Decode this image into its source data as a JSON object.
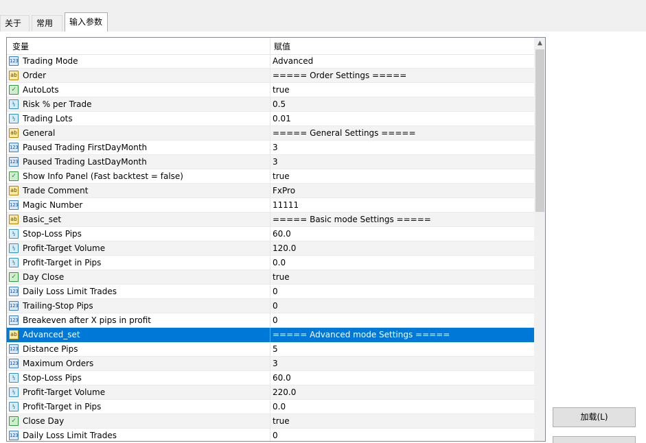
{
  "tabs": [
    {
      "label": "关于"
    },
    {
      "label": "常用"
    },
    {
      "label": "输入参数"
    }
  ],
  "columns": {
    "variable": "变量",
    "value": "赋值"
  },
  "rows": [
    {
      "type": "int",
      "name": "Trading Mode",
      "value": "Advanced"
    },
    {
      "type": "string",
      "name": "Order",
      "value": "===== Order Settings ====="
    },
    {
      "type": "bool",
      "name": "AutoLots",
      "value": "true"
    },
    {
      "type": "double",
      "name": "Risk % per Trade",
      "value": "0.5"
    },
    {
      "type": "double",
      "name": "Trading Lots",
      "value": "0.01"
    },
    {
      "type": "string",
      "name": "General",
      "value": "===== General Settings ====="
    },
    {
      "type": "int",
      "name": "Paused Trading FirstDayMonth",
      "value": "3"
    },
    {
      "type": "int",
      "name": "Paused Trading LastDayMonth",
      "value": "3"
    },
    {
      "type": "bool",
      "name": "Show Info Panel (Fast backtest = false)",
      "value": "true"
    },
    {
      "type": "string",
      "name": "Trade Comment",
      "value": "FxPro"
    },
    {
      "type": "int",
      "name": "Magic Number",
      "value": "11111"
    },
    {
      "type": "string",
      "name": "Basic_set",
      "value": "===== Basic mode Settings ====="
    },
    {
      "type": "double",
      "name": "Stop-Loss Pips",
      "value": "60.0"
    },
    {
      "type": "double",
      "name": "Profit-Target Volume",
      "value": "120.0"
    },
    {
      "type": "double",
      "name": "Profit-Target in Pips",
      "value": "0.0"
    },
    {
      "type": "bool",
      "name": "Day Close",
      "value": "true"
    },
    {
      "type": "int",
      "name": "Daily Loss Limit Trades",
      "value": "0"
    },
    {
      "type": "int",
      "name": "Trailing-Stop Pips",
      "value": "0"
    },
    {
      "type": "int",
      "name": "Breakeven after X pips in profit",
      "value": "0"
    },
    {
      "type": "string",
      "name": "Advanced_set",
      "value": "===== Advanced mode Settings =====",
      "selected": true
    },
    {
      "type": "int",
      "name": "Distance Pips",
      "value": "5"
    },
    {
      "type": "int",
      "name": "Maximum Orders",
      "value": "3"
    },
    {
      "type": "double",
      "name": "Stop-Loss Pips",
      "value": "60.0"
    },
    {
      "type": "double",
      "name": "Profit-Target Volume",
      "value": "220.0"
    },
    {
      "type": "double",
      "name": "Profit-Target in Pips",
      "value": "0.0"
    },
    {
      "type": "bool",
      "name": "Close Day",
      "value": "true"
    },
    {
      "type": "int",
      "name": "Daily Loss Limit Trades",
      "value": "0"
    }
  ],
  "icons": {
    "int": {
      "glyph": "123",
      "name": "integer-type-icon"
    },
    "string": {
      "glyph": "ab",
      "name": "string-type-icon"
    },
    "bool": {
      "glyph": "✓",
      "name": "boolean-type-icon"
    },
    "double": {
      "glyph": "½",
      "name": "double-type-icon"
    }
  },
  "buttons": {
    "load": "加载(L)"
  },
  "colors": {
    "selection": "#0078d7"
  }
}
